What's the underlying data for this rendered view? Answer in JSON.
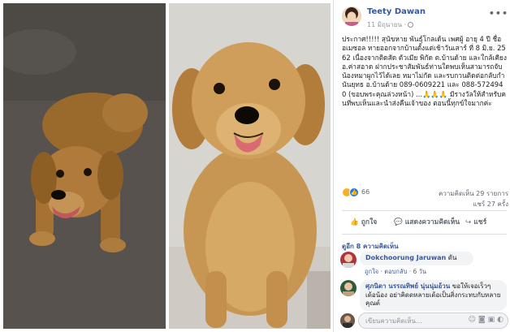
{
  "post": {
    "author": "Teety Dawan",
    "date": "11 มิถุนายน ·",
    "more_label": "•••",
    "text": "ประกาศ!!!!! สุนัขหาย พันธุ์โกลเด้น เพศผู้ อายุ 4 ปี ชื่อ อเมซอล หายออกจากบ้านตั้งแต่เช้าวันเสาร์ ที่ 8 มิ.ย. 2562 เนื่องจากติดสัด ตัวเมีย พิกัด ต.บ้านด้าย และใกล้เคียง อ.ค่าสอาด ฝากประชาสัมพันธ์ท่านใดพบเห็นสามารถจับน้องหมาผูกไว้ได้เลย หมาไม่กัด และรบกวนติดต่อกลับกำนันยุทธ อ.บ้านด้าย 089-0609221 และ 088-5724940 (ขอบพระคุณล่วงหน้า) ...🙏🙏🙏 มีรางวัลให้สำหรับคนที่พบเห็นและนำส่งคืนเจ้าของ ตอนนี้ทุกข์ใจมากค่ะ"
  },
  "stats": {
    "reactions": "66",
    "comments": "ความคิดเห็น 29 รายการ",
    "shares": "แชร์ 27 ครั้ง"
  },
  "actions": {
    "like": "ถูกใจ",
    "comment": "แสดงความคิดเห็น",
    "share": "แชร์"
  },
  "comments": {
    "previous": "ดูอีก 8 ความคิดเห็น",
    "items": [
      {
        "name": "Dokchoorung Jaruwan",
        "text": "ดัน",
        "like": "ถูกใจ",
        "reply": "ตอบกลับ",
        "time": "6 วัน"
      },
      {
        "name": "ศุภนิดา นรรณทิพย์ นุ่นนุ่มอ้วน",
        "text": "ขอให้เจอเร็วๆ เด้อน้อง อย่าคิดดหลายเด้อเป็นสิ่งกระทบกับหลายคุณต์"
      }
    ]
  },
  "composer": {
    "placeholder": "เขียนความคิดเห็น...",
    "icons": [
      "emoji-icon",
      "camera-icon",
      "gif-icon",
      "sticker-icon"
    ]
  },
  "colors": {
    "link": "#385898",
    "muted": "#606770",
    "like_blue": "#1877f2",
    "sad_yellow": "#f7b125"
  }
}
